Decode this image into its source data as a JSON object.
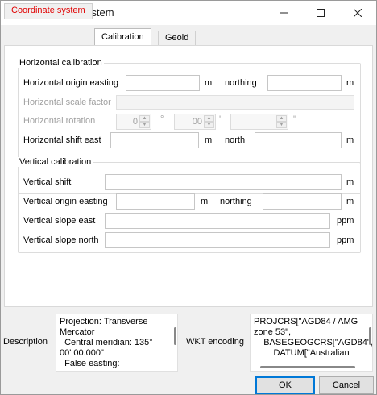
{
  "window": {
    "title": "Coordinate System",
    "icon": "app-logo-icon",
    "controls": [
      "minimize-icon",
      "maximize-icon",
      "close-icon"
    ]
  },
  "tabs": [
    {
      "label": "Coordinate system",
      "color": "#e00000"
    },
    {
      "label": "Calibration",
      "active": true
    },
    {
      "label": "Geoid"
    }
  ],
  "horizontal": {
    "title": "Horizontal calibration",
    "origin_easting_label": "Horizontal origin easting",
    "origin_easting_value": "",
    "origin_easting_unit": "m",
    "northing_label": "northing",
    "northing_value": "",
    "northing_unit": "m",
    "scale_factor_label": "Horizontal scale factor",
    "scale_factor_value": "",
    "rotation_label": "Horizontal rotation",
    "rotation_degrees": "0",
    "degree_symbol": "°",
    "rotation_minutes": "00",
    "minute_symbol": "'",
    "rotation_seconds": "",
    "second_symbol": "\"",
    "shift_east_label": "Horizontal shift east",
    "shift_east_value": "",
    "shift_east_unit": "m",
    "shift_north_label": "north",
    "shift_north_value": "",
    "shift_north_unit": "m"
  },
  "vertical": {
    "title": "Vertical calibration",
    "shift_label": "Vertical shift",
    "shift_value": "",
    "shift_unit": "m",
    "origin_easting_label": "Vertical origin easting",
    "origin_easting_value": "",
    "origin_easting_unit": "m",
    "northing_label": "northing",
    "northing_value": "",
    "northing_unit": "m",
    "slope_east_label": "Vertical slope east",
    "slope_east_value": "",
    "slope_east_unit": "ppm",
    "slope_north_label": "Vertical slope north",
    "slope_north_value": "",
    "slope_north_unit": "ppm"
  },
  "bottom": {
    "description_label": "Description",
    "description_lines": [
      "Projection: Transverse",
      "Mercator",
      "  Central meridian: 135°",
      "00' 00.000\"",
      "  False easting:"
    ],
    "wkt_label": "WKT encoding",
    "wkt_lines": [
      "PROJCRS[\"AGD84 / AMG",
      "zone 53\",",
      "    BASEGEOGCRS[\"AGD84\",",
      "        DATUM[\"Australian"
    ]
  },
  "buttons": {
    "ok": "OK",
    "cancel": "Cancel"
  }
}
